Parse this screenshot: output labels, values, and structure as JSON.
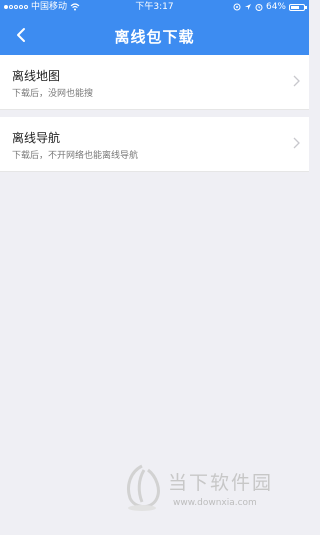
{
  "status_bar": {
    "carrier": "中国移动",
    "time": "下午3:17",
    "battery": "64%",
    "battery_level": 0.64,
    "icons": [
      "signal-dots-icon",
      "wifi-icon",
      "location-icon",
      "alarm-icon",
      "battery-icon"
    ]
  },
  "nav": {
    "title": "离线包下载",
    "back_icon": "chevron-left-icon"
  },
  "items": [
    {
      "title": "离线地图",
      "subtitle": "下载后，没网也能搜"
    },
    {
      "title": "离线导航",
      "subtitle": "下载后，不开网络也能离线导航"
    }
  ],
  "watermark": {
    "text": "当下软件园",
    "url": "www.downxia.com"
  },
  "colors": {
    "header": "#3d8cf1",
    "background": "#efeff4",
    "item_bg": "#ffffff"
  }
}
